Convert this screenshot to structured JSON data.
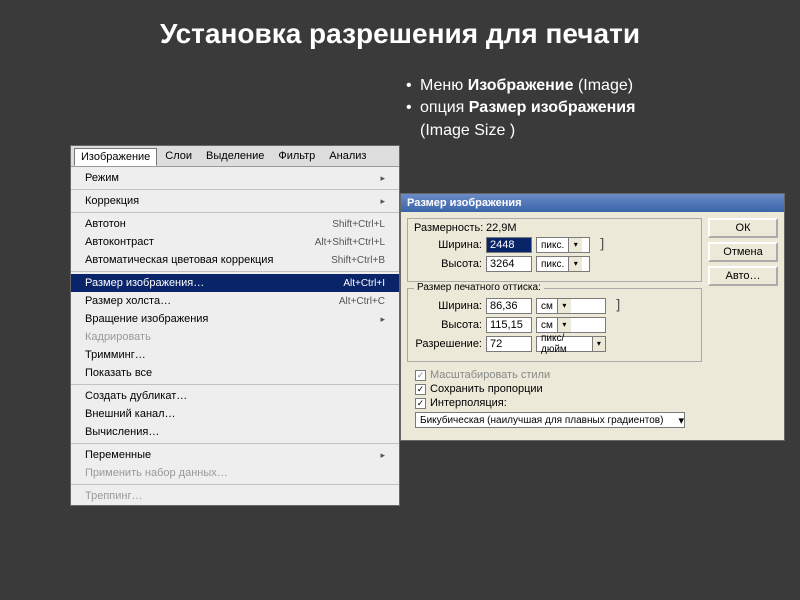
{
  "slide": {
    "title": "Установка разрешения для печати",
    "bullets": [
      {
        "prefix": "Меню ",
        "strong": "Изображение",
        "suffix": " (Image)"
      },
      {
        "prefix": " опция ",
        "strong": "Размер изображения",
        "suffix2": " (Image Size )"
      }
    ]
  },
  "tabs": {
    "active": "Изображение",
    "t1": "Слои",
    "t2": "Выделение",
    "t3": "Фильтр",
    "t4": "Анализ"
  },
  "menu": {
    "rezhim": "Режим",
    "korrektsiya": "Коррекция",
    "avtoton": "Автотон",
    "avtoton_sc": "Shift+Ctrl+L",
    "avtokontrast": "Автоконтраст",
    "avtokontrast_sc": "Alt+Shift+Ctrl+L",
    "avtocolor": "Автоматическая цветовая коррекция",
    "avtocolor_sc": "Shift+Ctrl+B",
    "imagesize": "Размер изображения…",
    "imagesize_sc": "Alt+Ctrl+I",
    "canvassize": "Размер холста…",
    "canvassize_sc": "Alt+Ctrl+C",
    "rotate": "Вращение изображения",
    "crop": "Кадрировать",
    "trim": "Тримминг…",
    "reveal": "Показать все",
    "duplicate": "Создать дубликат…",
    "apply": "Внешний канал…",
    "calc": "Вычисления…",
    "vars": "Переменные",
    "dataset": "Применить набор данных…",
    "trap": "Треппинг…"
  },
  "dialog": {
    "title": "Размер изображения",
    "dim_label": "Размерность:",
    "dim_value": "22,9М",
    "width_label": "Ширина:",
    "height_label": "Высота:",
    "px_group_title": "",
    "width_px": "2448",
    "height_px": "3264",
    "unit_px": "пикс.",
    "doc_group": "Размер печатного оттиска:",
    "width_cm": "86,36",
    "height_cm": "115,15",
    "unit_cm": "см",
    "res_label": "Разрешение:",
    "res_val": "72",
    "res_unit": "пикс/дюйм",
    "styles": "Масштабировать стили",
    "constrain": "Сохранить пропорции",
    "resample": "Интерполяция:",
    "interp": "Бикубическая (наилучшая для плавных градиентов)",
    "ok": "ОК",
    "cancel": "Отмена",
    "auto": "Авто…"
  }
}
